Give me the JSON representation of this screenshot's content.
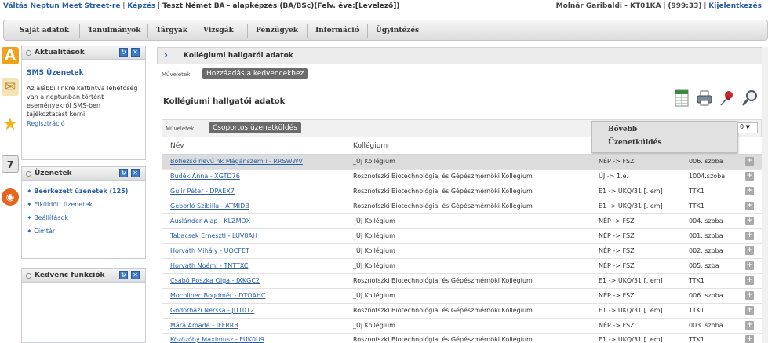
{
  "topbar": {
    "app_name": "Váltás Neptun Meet Street-re",
    "kepzes_label": "Képzés",
    "training": "Teszt Német BA - alapképzés (BA/BSc)(Felv. éve:[Levelező])",
    "user": "Molnár Garibaldi - KT01KA",
    "code": "(999:33)",
    "logout": "Kijelentkezés"
  },
  "menu": [
    "Saját adatok",
    "Tanulmányok",
    "Tárgyak",
    "Vizsgák",
    "Pénzügyek",
    "Információ",
    "Ügyintézés"
  ],
  "left_icons": [
    {
      "name": "a-letter-icon",
      "color": "#f0a21b",
      "glyph": "A"
    },
    {
      "name": "envelope-icon",
      "color": "#e7c27a",
      "glyph": "✉"
    },
    {
      "name": "star-icon",
      "color": "#f2b21c",
      "glyph": "★"
    },
    {
      "name": "calendar-icon",
      "color": "#d9d9d9",
      "glyph": "7"
    },
    {
      "name": "chat-icon",
      "color": "#e4651e",
      "glyph": "◉"
    }
  ],
  "news_box": {
    "title": "Aktualitások",
    "link": "SMS Üzenetek",
    "text": "Az alábbi linkre kattintva lehetőség van a neptunban történt eseményekről SMS-ben tájékoztatást kérni.",
    "register": "Regisztráció"
  },
  "messages_box": {
    "title": "Üzenetek",
    "items": [
      "Beérkezett üzenetek (125)",
      "Elküldött üzenetek",
      "Beállítások",
      "Címtár"
    ]
  },
  "fav_box": {
    "title": "Kedvenc funkciók"
  },
  "main": {
    "title": "Kollégiumi hallgatói adatok",
    "muveletek_label": "Műveletek:",
    "add_favorite": "Hozzáadás a kedvencekhez",
    "subtitle": "Kollégiumi hallgatói adatok",
    "group_message": "Csoportos üzenetküldés",
    "popup_items": [
      "Bővebb",
      "Üzenetküldés"
    ],
    "pager_value": "0",
    "col_name": "Név",
    "col_dorm": "Kollégium"
  },
  "rows": [
    {
      "name": "Bofiezső nevű nk Mágánszem i - RRSWWV",
      "dorm": "_Új Kollégium",
      "status": "NÉP -> FSZ",
      "room": "006. szoba",
      "selected": true
    },
    {
      "name": "Budék Anna - XGTD76",
      "dorm": "Rosznofszki Biotechnológiai és Gépészmérnöki Kollégium",
      "status": "ÚJ -> 1.e.",
      "room": "1004.szoba",
      "selected": false
    },
    {
      "name": "Gulir Péter - DPAEX7",
      "dorm": "Rosznofszki Biotechnológiai és Gépészmérnöki Kollégium",
      "status": "E1 -> UKQ/31 [. em]",
      "room": "TTK1",
      "selected": false
    },
    {
      "name": "Geborló Szibilla - ATMIDB",
      "dorm": "Rosznofszki Biotechnológiai és Gépészmérnöki Kollégium",
      "status": "E1 -> UKQ/31 [. em]",
      "room": "TTK1",
      "selected": false
    },
    {
      "name": "Auslánder Alap - KLZMDX",
      "dorm": "_Új Kollégium",
      "status": "NÉP -> FSZ",
      "room": "004. szoba",
      "selected": false
    },
    {
      "name": "Tabacsek Ernesztl - LUV8AH",
      "dorm": "_Új Kollégium",
      "status": "NÉP -> FSZ",
      "room": "001. szoba",
      "selected": false
    },
    {
      "name": "Horváth Mihály - UOCFET",
      "dorm": "_Új Kollégium",
      "status": "NÉP -> FSZ",
      "room": "002. szoba",
      "selected": false
    },
    {
      "name": "Horváth Noémi - TNTTXC",
      "dorm": "_Új Kollégium",
      "status": "NÉP -> FSZ",
      "room": "005. szba",
      "selected": false
    },
    {
      "name": "Csabó Roszka Olga - IXKGC2",
      "dorm": "Rosznofszki Biotechnológiai és Gépészmérnöki Kollégium",
      "status": "E1 -> UKQ/31 [. em]",
      "room": "TTK1",
      "selected": false
    },
    {
      "name": "Mochlinec Bogdmér - DTOAHC",
      "dorm": "_Új Kollégium",
      "status": "NÉP -> FSZ",
      "room": "006. szoba",
      "selected": false
    },
    {
      "name": "Gödörházi Nerssa - JU1012",
      "dorm": "Rosznofszki Biotechnológiai és Gépészmérnöki Kollégium",
      "status": "E1 -> UKQ/31 [. em]",
      "room": "TTK1",
      "selected": false
    },
    {
      "name": "Márá Amadé - IFFRRB",
      "dorm": "_Új Kollégium",
      "status": "NÉP -> FSZ",
      "room": "003. szoba",
      "selected": false
    },
    {
      "name": "Közözőhy Maximusz - FUK0U9",
      "dorm": "Rosznofszki Biotechnológiai és Gépészmérnöki Kollégium",
      "status": "E1 -> UKQ/31 [. em]",
      "room": "TTK1",
      "selected": false
    }
  ],
  "row_button": "+"
}
